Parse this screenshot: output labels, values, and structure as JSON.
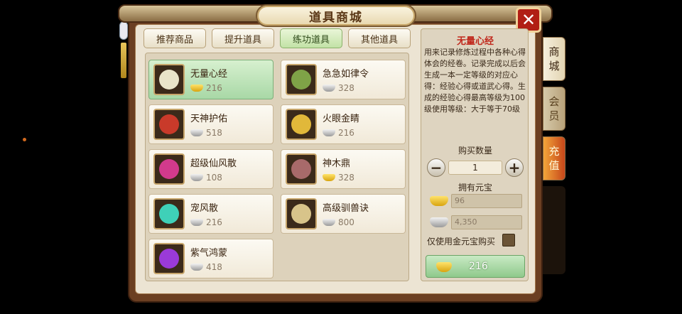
{
  "title": "道具商城",
  "tabs": [
    "推荐商品",
    "提升道具",
    "练功道具",
    "其他道具"
  ],
  "active_tab": 2,
  "side_tabs": {
    "shop": [
      "商",
      "城"
    ],
    "member": [
      "会",
      "员"
    ],
    "charge": [
      "充",
      "值"
    ]
  },
  "items": [
    {
      "name": "无量心经",
      "currency": "gold",
      "price": "216",
      "color": "#e9e4c9"
    },
    {
      "name": "急急如律令",
      "currency": "silver",
      "price": "328",
      "color": "#7fa347"
    },
    {
      "name": "天神护佑",
      "currency": "silver",
      "price": "518",
      "color": "#c93a2a"
    },
    {
      "name": "火眼金睛",
      "currency": "silver",
      "price": "216",
      "color": "#e1b83a"
    },
    {
      "name": "超级仙风散",
      "currency": "silver",
      "price": "108",
      "color": "#d23a8c"
    },
    {
      "name": "神木鼎",
      "currency": "gold",
      "price": "328",
      "color": "#a86a6a"
    },
    {
      "name": "宠风散",
      "currency": "silver",
      "price": "216",
      "color": "#3fd0b8"
    },
    {
      "name": "高级驯兽诀",
      "currency": "silver",
      "price": "800",
      "color": "#d8c48a"
    },
    {
      "name": "紫气鸿蒙",
      "currency": "silver",
      "price": "418",
      "color": "#9a3ad8"
    }
  ],
  "detail": {
    "title": "无量心经",
    "description": "用来记录修炼过程中各种心得体会的经卷。记录完成以后会生成一本一定等级的对应心得：经验心得或道武心得。生成的经验心得最高等级为100级使用等级：大于等于70级",
    "qty_label": "购买数量",
    "qty_value": "1",
    "own_label": "拥有元宝",
    "gold_owned": "96",
    "silver_owned": "4,350",
    "gold_only_label": "仅使用金元宝购买",
    "buy_price": "216"
  },
  "colors": {
    "gold": "#ffd84a",
    "silver": "#c8c8c8",
    "selected": "#a8d8a6",
    "title_red": "#c0281c"
  }
}
